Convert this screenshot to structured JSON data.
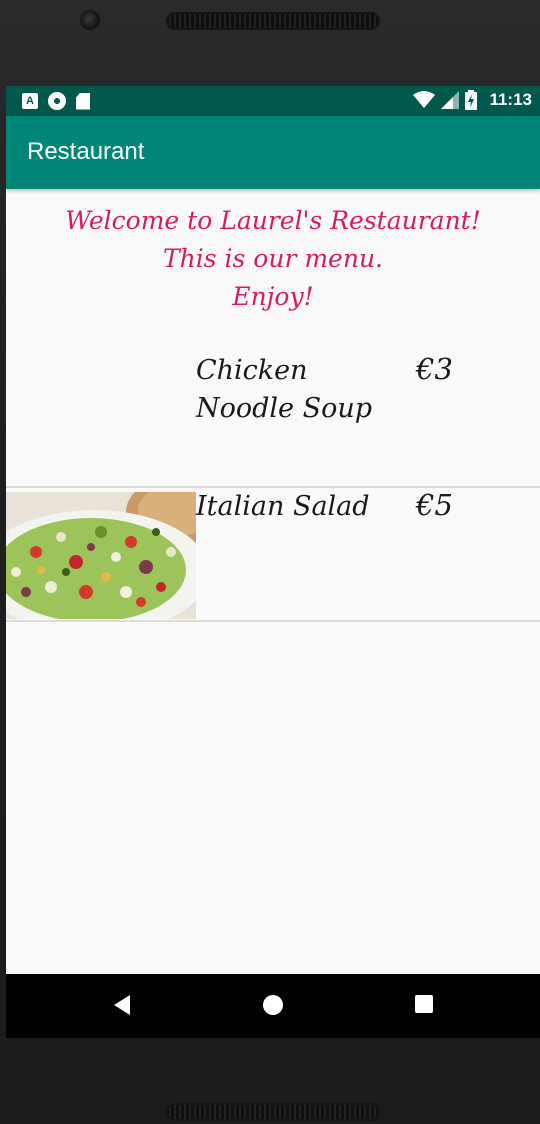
{
  "status_bar": {
    "time": "11:13",
    "icons": [
      "accessibility-a-icon",
      "sync-circle-icon",
      "sd-card-icon",
      "wifi-icon",
      "signal-icon",
      "battery-charging-icon"
    ],
    "background": "#00574b"
  },
  "app_bar": {
    "title": "Restaurant",
    "background": "#008577"
  },
  "welcome": {
    "line1": "Welcome to Laurel's Restaurant!",
    "line2": "This is our menu.",
    "line3": "Enjoy!",
    "color": "#d81b60"
  },
  "menu": {
    "items": [
      {
        "name": "Chicken Noodle Soup",
        "price": "€3",
        "has_image": false
      },
      {
        "name": "Italian Salad",
        "price": "€5",
        "has_image": true,
        "image": "italian-salad-photo"
      }
    ]
  },
  "nav_bar": {
    "icons": [
      "back-icon",
      "home-icon",
      "recents-icon"
    ]
  }
}
